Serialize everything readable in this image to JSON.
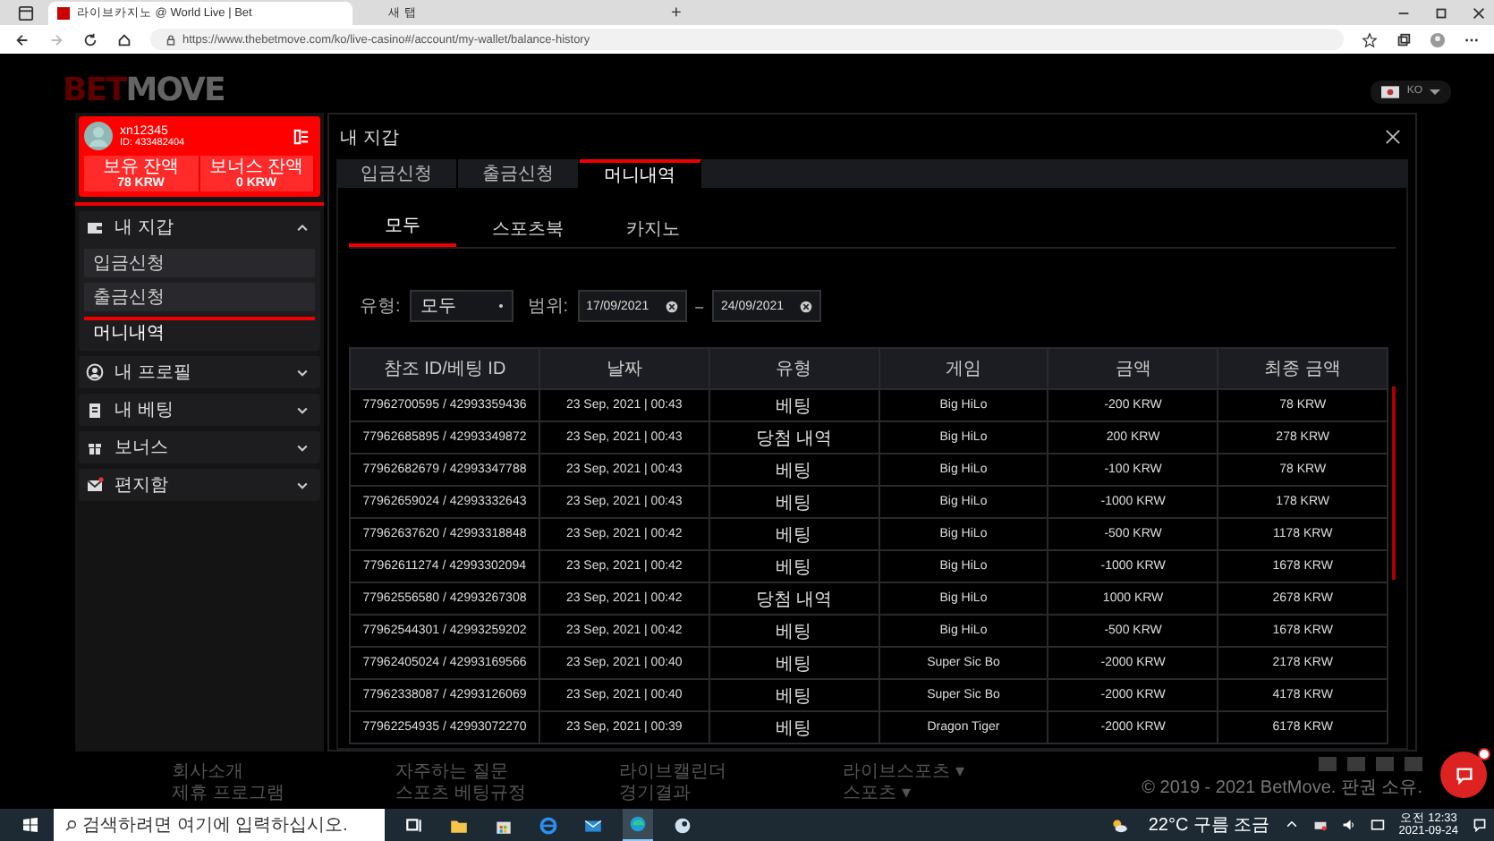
{
  "browser": {
    "tabs": [
      {
        "title": "라이브카지노 @ World Live | Bet",
        "selected": true
      },
      {
        "title": "새 탭",
        "selected": false
      }
    ],
    "new_tab": "+",
    "url": "https://www.thebetmove.com/ko/live-casino#/account/my-wallet/balance-history"
  },
  "site": {
    "logo": {
      "first": "BET",
      "second": "MOVE"
    },
    "language": "KO"
  },
  "account": {
    "username": "xn12345",
    "id": "ID: 433482404",
    "balances": [
      {
        "label": "보유 잔액",
        "amount": "78 KRW"
      },
      {
        "label": "보너스 잔액",
        "amount": "0 KRW"
      }
    ]
  },
  "menu": [
    {
      "label": "내 지갑",
      "expanded": true,
      "children": [
        {
          "label": "입금신청",
          "selected": false
        },
        {
          "label": "출금신청",
          "selected": false
        },
        {
          "label": "머니내역",
          "selected": true
        }
      ]
    },
    {
      "label": "내 프로필",
      "expanded": false
    },
    {
      "label": "내 베팅",
      "expanded": false
    },
    {
      "label": "보너스",
      "expanded": false
    },
    {
      "label": "편지함",
      "expanded": false
    }
  ],
  "modal": {
    "title": "내 지갑",
    "tabs": [
      {
        "label": "입금신청",
        "selected": false
      },
      {
        "label": "출금신청",
        "selected": false
      },
      {
        "label": "머니내역",
        "selected": true
      }
    ],
    "subtabs": [
      {
        "label": "모두",
        "selected": true
      },
      {
        "label": "스포츠북",
        "selected": false
      },
      {
        "label": "카지노",
        "selected": false
      }
    ],
    "filter": {
      "type_label": "유형:",
      "type_value": "모두",
      "range_label": "범위:",
      "from": "17/09/2021",
      "separator": "–",
      "to": "24/09/2021"
    },
    "table": {
      "columns": [
        "참조 ID/베팅 ID",
        "날짜",
        "유형",
        "게임",
        "금액",
        "최종 금액"
      ],
      "rows": [
        [
          "77962700595 / 42993359436",
          "23 Sep, 2021 | 00:43",
          "베팅",
          "Big HiLo",
          "-200 KRW",
          "78 KRW"
        ],
        [
          "77962685895 / 42993349872",
          "23 Sep, 2021 | 00:43",
          "당첨 내역",
          "Big HiLo",
          "200 KRW",
          "278 KRW"
        ],
        [
          "77962682679 / 42993347788",
          "23 Sep, 2021 | 00:43",
          "베팅",
          "Big HiLo",
          "-100 KRW",
          "78 KRW"
        ],
        [
          "77962659024 / 42993332643",
          "23 Sep, 2021 | 00:43",
          "베팅",
          "Big HiLo",
          "-1000 KRW",
          "178 KRW"
        ],
        [
          "77962637620 / 42993318848",
          "23 Sep, 2021 | 00:42",
          "베팅",
          "Big HiLo",
          "-500 KRW",
          "1178 KRW"
        ],
        [
          "77962611274 / 42993302094",
          "23 Sep, 2021 | 00:42",
          "베팅",
          "Big HiLo",
          "-1000 KRW",
          "1678 KRW"
        ],
        [
          "77962556580 / 42993267308",
          "23 Sep, 2021 | 00:42",
          "당첨 내역",
          "Big HiLo",
          "1000 KRW",
          "2678 KRW"
        ],
        [
          "77962544301 / 42993259202",
          "23 Sep, 2021 | 00:42",
          "베팅",
          "Big HiLo",
          "-500 KRW",
          "1678 KRW"
        ],
        [
          "77962405024 / 42993169566",
          "23 Sep, 2021 | 00:40",
          "베팅",
          "Super Sic Bo",
          "-2000 KRW",
          "2178 KRW"
        ],
        [
          "77962338087 / 42993126069",
          "23 Sep, 2021 | 00:40",
          "베팅",
          "Super Sic Bo",
          "-2000 KRW",
          "4178 KRW"
        ],
        [
          "77962254935 / 42993072270",
          "23 Sep, 2021 | 00:39",
          "베팅",
          "Dragon Tiger",
          "-2000 KRW",
          "6178 KRW"
        ]
      ]
    }
  },
  "footer": {
    "columns": [
      [
        "회사소개",
        "제휴 프로그램"
      ],
      [
        "자주하는 질문",
        "스포츠 베팅규정"
      ],
      [
        "라이브캘린더",
        "경기결과"
      ],
      [
        "라이브스포츠 ▾",
        "스포츠 ▾"
      ]
    ],
    "copyright": "© 2019 - 2021 BetMove. 판권 소유."
  },
  "taskbar": {
    "search_placeholder": "검색하려면 여기에 입력하십시오.",
    "weather": "22°C 구름 조금",
    "time": "오전 12:33",
    "date": "2021-09-24"
  }
}
